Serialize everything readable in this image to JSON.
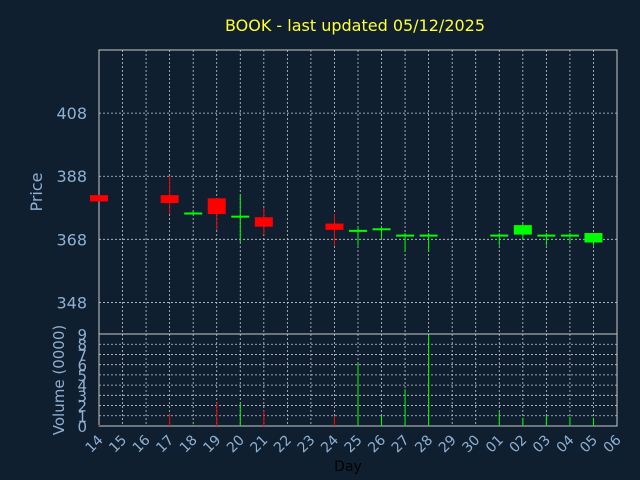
{
  "chart_data": {
    "type": "candlestick",
    "title": "BOOK - last updated 05/12/2025",
    "ylabel": "Price",
    "volume_ylabel": "Volume (0000)",
    "xlabel": "Day",
    "price_ylim": [
      338,
      428
    ],
    "price_ticks": [
      "408",
      "388",
      "368",
      "348"
    ],
    "price_tick_values": [
      408,
      388,
      368,
      348
    ],
    "volume_ylim": [
      0,
      9
    ],
    "volume_ticks": [
      "0",
      "1",
      "2",
      "3",
      "4",
      "5",
      "6",
      "7",
      "8",
      "9"
    ],
    "x_labels": [
      "14",
      "15",
      "16",
      "17",
      "18",
      "19",
      "20",
      "21",
      "22",
      "23",
      "24",
      "25",
      "26",
      "27",
      "28",
      "29",
      "30",
      "01",
      "02",
      "03",
      "04",
      "05",
      "06"
    ],
    "candles": [
      {
        "day": "14",
        "open": 382,
        "close": 380,
        "high": 382,
        "low": 380,
        "volume": 0.1
      },
      {
        "day": "17",
        "open": 382,
        "close": 379.5,
        "high": 388,
        "low": 376,
        "volume": 1.2
      },
      {
        "day": "18",
        "open": 376,
        "close": 376.5,
        "high": 377,
        "low": 376,
        "volume": 0.1
      },
      {
        "day": "19",
        "open": 381,
        "close": 376,
        "high": 381,
        "low": 371,
        "volume": 2.3
      },
      {
        "day": "20",
        "open": 375,
        "close": 375.5,
        "high": 382,
        "low": 367,
        "volume": 2.2
      },
      {
        "day": "21",
        "open": 375,
        "close": 372,
        "high": 378,
        "low": 369.5,
        "volume": 1.5
      },
      {
        "day": "24",
        "open": 373,
        "close": 371,
        "high": 376,
        "low": 366,
        "volume": 1.0
      },
      {
        "day": "25",
        "open": 370.5,
        "close": 371,
        "high": 372,
        "low": 366,
        "volume": 6.1
      },
      {
        "day": "26",
        "open": 371,
        "close": 371.5,
        "high": 372,
        "low": 368,
        "volume": 1.0
      },
      {
        "day": "27",
        "open": 369,
        "close": 369.5,
        "high": 370,
        "low": 364,
        "volume": 3.6
      },
      {
        "day": "28",
        "open": 369,
        "close": 369.5,
        "high": 370,
        "low": 364,
        "volume": 8.9
      },
      {
        "day": "01",
        "open": 369,
        "close": 369.5,
        "high": 370,
        "low": 366,
        "volume": 1.4
      },
      {
        "day": "02",
        "open": 369.5,
        "close": 372.5,
        "high": 373,
        "low": 368,
        "volume": 0.8
      },
      {
        "day": "03",
        "open": 369,
        "close": 369.5,
        "high": 370,
        "low": 366,
        "volume": 1.0
      },
      {
        "day": "04",
        "open": 369,
        "close": 369.5,
        "high": 370,
        "low": 367,
        "volume": 0.9
      },
      {
        "day": "05",
        "open": 367,
        "close": 370,
        "high": 370,
        "low": 366,
        "volume": 0.8
      }
    ],
    "colors": {
      "up": "#00ff00",
      "down": "#ff0000",
      "background": "#0f1f30",
      "grid": "#c8c8c8",
      "title": "#ffff33",
      "text": "#8fb0d0"
    },
    "grid": true
  }
}
